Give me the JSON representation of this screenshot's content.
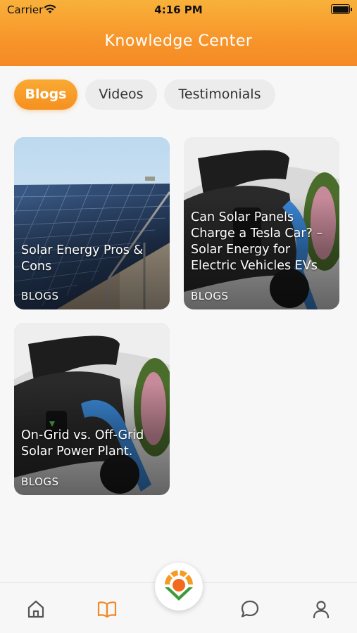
{
  "status_bar": {
    "carrier": "Carrier",
    "time": "4:16 PM"
  },
  "header": {
    "title": "Knowledge Center"
  },
  "tabs": [
    {
      "label": "Blogs",
      "active": true
    },
    {
      "label": "Videos",
      "active": false
    },
    {
      "label": "Testimonials",
      "active": false
    }
  ],
  "cards": [
    {
      "title": "Solar Energy Pros & Cons",
      "tag": "BLOGS",
      "image": "solar-panels"
    },
    {
      "title": "Can Solar Panels Charge a Tesla Car? – Solar Energy for Electric Vehicles EVs",
      "tag": "BLOGS",
      "image": "ev-charging"
    },
    {
      "title": "On-Grid vs. Off-Grid Solar Power Plant.",
      "tag": "BLOGS",
      "image": "ev-charging"
    }
  ],
  "tabbar": {
    "items": [
      {
        "icon": "home-icon",
        "active": false
      },
      {
        "icon": "book-icon",
        "active": true
      },
      {
        "icon": "app-logo",
        "active": false
      },
      {
        "icon": "chat-icon",
        "active": false
      },
      {
        "icon": "user-icon",
        "active": false
      }
    ]
  },
  "colors": {
    "accent": "#f7952a",
    "active_icon": "#f08a25",
    "inactive_icon": "#555555"
  }
}
